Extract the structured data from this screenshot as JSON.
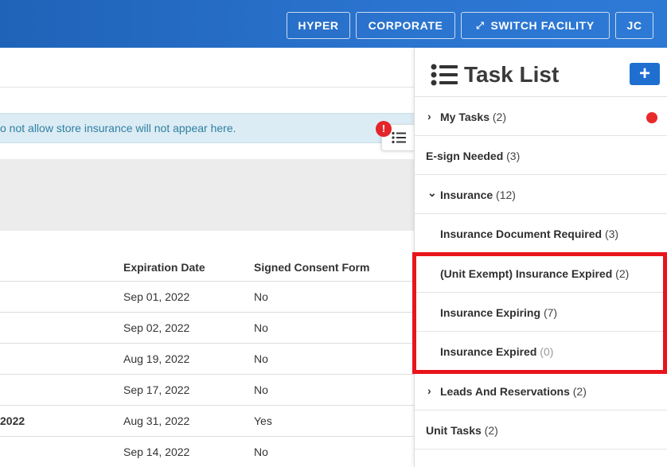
{
  "topbar": {
    "buttons": [
      {
        "label": "HYPER"
      },
      {
        "label": "CORPORATE"
      },
      {
        "label": "SWITCH FACILITY",
        "icon": "expand-arrows-icon"
      },
      {
        "label": "JC"
      }
    ]
  },
  "notice": {
    "text": "o not allow store insurance will not appear here."
  },
  "alert_badge": "!",
  "table": {
    "columns": [
      "Expiration Date",
      "Signed Consent Form"
    ],
    "rows": [
      {
        "name": "",
        "expiration": "Sep 01, 2022",
        "consent": "No"
      },
      {
        "name": "",
        "expiration": "Sep 02, 2022",
        "consent": "No"
      },
      {
        "name": "",
        "expiration": "Aug 19, 2022",
        "consent": "No"
      },
      {
        "name": "",
        "expiration": "Sep 17, 2022",
        "consent": "No"
      },
      {
        "name": "2022",
        "expiration": "Aug 31, 2022",
        "consent": "Yes"
      },
      {
        "name": "",
        "expiration": "Sep 14, 2022",
        "consent": "No"
      }
    ]
  },
  "task_panel": {
    "title": "Task List",
    "add_label": "+",
    "items": [
      {
        "label": "My Tasks",
        "count": "(2)",
        "chevron": "›"
      },
      {
        "label": "E-sign Needed",
        "count": "(3)"
      },
      {
        "label": "Insurance",
        "count": "(12)",
        "chevron": "⌄"
      },
      {
        "label": "Insurance Document Required",
        "count": "(3)"
      },
      {
        "label": "(Unit Exempt) Insurance Expired",
        "count": "(2)"
      },
      {
        "label": "Insurance Expiring",
        "count": "(7)"
      },
      {
        "label": "Insurance Expired",
        "count": "(0)"
      },
      {
        "label": "Leads And Reservations",
        "count": "(2)",
        "chevron": "›"
      },
      {
        "label": "Unit Tasks",
        "count": "(2)"
      }
    ]
  },
  "colors": {
    "brand_blue": "#2b74cf",
    "highlight_red": "#e8141b",
    "notice_bg": "#dcecf4"
  }
}
